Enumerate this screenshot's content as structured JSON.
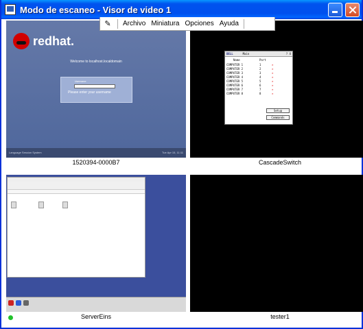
{
  "window": {
    "title": "Modo de escaneo - Visor de video 1"
  },
  "menu": {
    "items": [
      "Archivo",
      "Miniatura",
      "Opciones",
      "Ayuda"
    ]
  },
  "thumbnails": [
    {
      "label": "1520394-0000B7",
      "screen": {
        "brand": "redhat.",
        "welcome": "Welcome to localhost.localdomain",
        "username_label": "Username:",
        "prompt": "Please enter your username",
        "bar_left": "Language   Session   System",
        "bar_right": "Tue Apr 15, 11:11"
      }
    },
    {
      "label": "CascadeSwitch",
      "screen": {
        "logo": "DELL",
        "title": "Main",
        "help": "? X",
        "col_name": "Name",
        "col_port": "Port",
        "rows": [
          {
            "name": "COMPUTER 1",
            "port": "1"
          },
          {
            "name": "COMPUTER 2",
            "port": "2"
          },
          {
            "name": "COMPUTER 3",
            "port": "3"
          },
          {
            "name": "COMPUTER 4",
            "port": "4"
          },
          {
            "name": "COMPUTER 5",
            "port": "5"
          },
          {
            "name": "COMPUTER 6",
            "port": "6"
          },
          {
            "name": "COMPUTER 7",
            "port": "7"
          },
          {
            "name": "COMPUTER 8",
            "port": "8"
          }
        ],
        "setup": "Setup",
        "commands": "Commands"
      }
    },
    {
      "label": "ServerEins"
    },
    {
      "label": "tester1"
    }
  ],
  "colors": {
    "titlebar": "#0053ee",
    "close_red": "#d34a24",
    "status_green": "#21c12b",
    "dell_x": "#e00000"
  }
}
